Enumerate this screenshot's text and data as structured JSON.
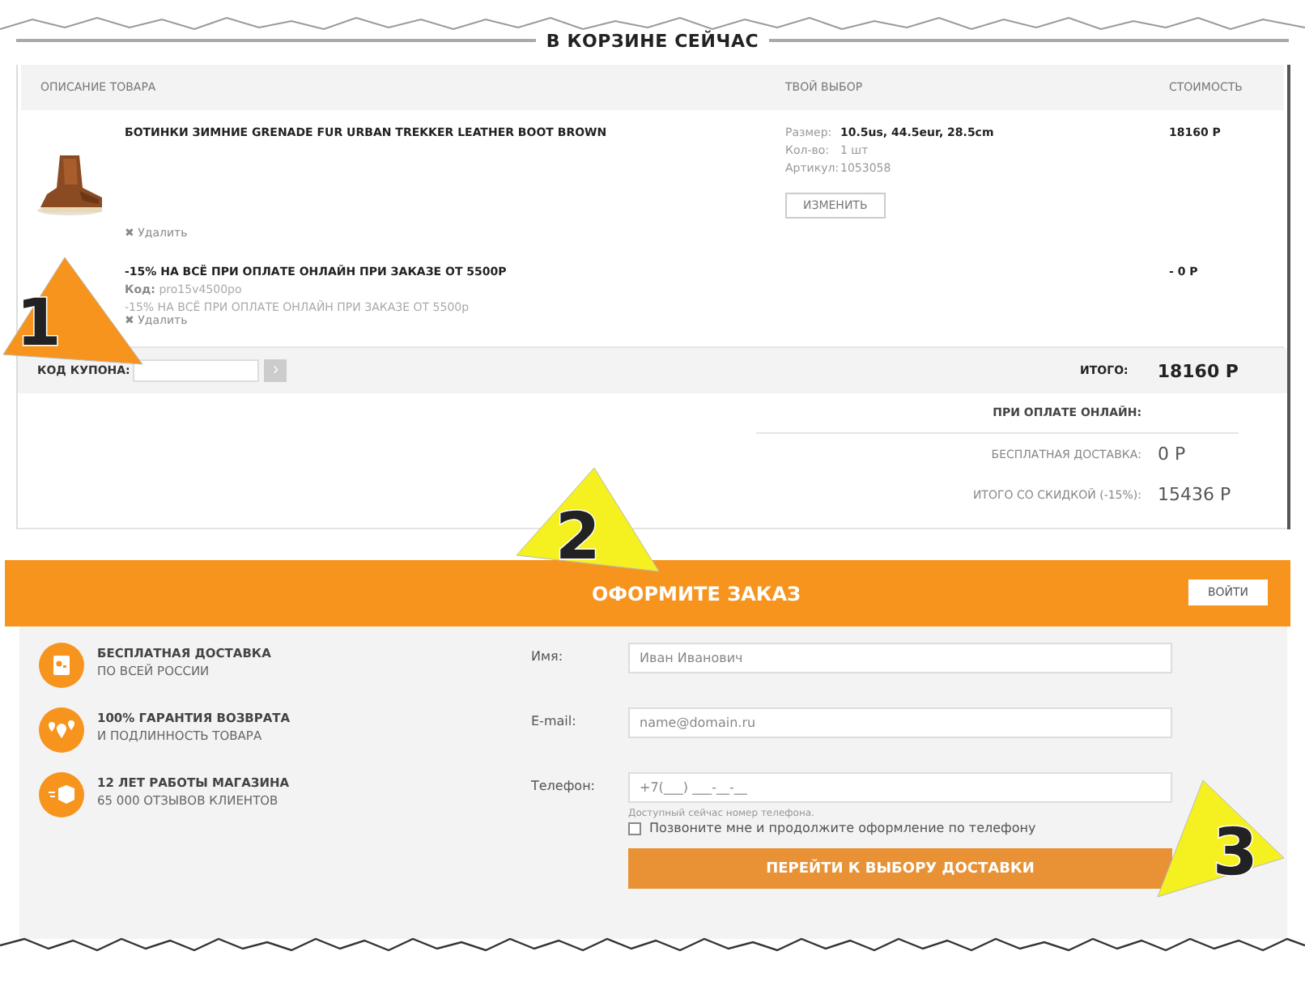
{
  "title": "В КОРЗИНЕ СЕЙЧАС",
  "columns": [
    "ОПИСАНИЕ ТОВАРА",
    "ТВОЙ ВЫБОР",
    "СТОИМОСТЬ"
  ],
  "product": {
    "name": "БОТИНКИ ЗИМНИЕ GRENADE FUR URBAN TREKKER LEATHER BOOT BROWN",
    "delete": "✖ Удалить",
    "options": [
      {
        "label": "Размер:",
        "value": "10.5us, 44.5eur, 28.5cm",
        "bold": true
      },
      {
        "label": "Кол-во:",
        "value": "1 шт",
        "bold": false
      },
      {
        "label": "Артикул:",
        "value": "1053058",
        "bold": false
      }
    ],
    "change_button": "ИЗМЕНИТЬ",
    "price": "18160 Р"
  },
  "promo": {
    "name": "-15% НА ВСЁ ПРИ ОПЛАТЕ ОНЛАЙН ПРИ ЗАКАЗЕ ОТ 5500Р",
    "code_label": "Код:",
    "code": "pro15v4500po",
    "description": "-15% НА ВСЁ ПРИ ОПЛАТЕ ОНЛАЙН ПРИ ЗАКАЗЕ ОТ 5500р",
    "delete": "✖ Удалить",
    "price": "- 0 Р"
  },
  "coupon": {
    "label": "КОД КУПОНА:",
    "submit": "›"
  },
  "total": {
    "label": "ИТОГО:",
    "value": "18160 Р"
  },
  "online": {
    "heading": "ПРИ ОПЛАТЕ ОНЛАЙН:",
    "rows": [
      {
        "label": "БЕСПЛАТНАЯ ДОСТАВКА:",
        "value": "0 Р"
      },
      {
        "label": "ИТОГО СО СКИДКОЙ (-15%):",
        "value": "15436 Р"
      }
    ]
  },
  "checkout": {
    "title": "ОФОРМИТЕ ЗАКАЗ",
    "login": "ВОЙТИ"
  },
  "features": [
    {
      "kind": "parcel",
      "title": "БЕСПЛАТНАЯ ДОСТАВКА",
      "subtitle": "ПО ВСЕЙ РОССИИ"
    },
    {
      "kind": "pins",
      "title": "100% ГАРАНТИЯ ВОЗВРАТА",
      "subtitle": "И ПОДЛИННОСТЬ ТОВАРА"
    },
    {
      "kind": "box",
      "title": "12 ЛЕТ РАБОТЫ МАГАЗИНА",
      "subtitle": "65 000 ОТЗЫВОВ КЛИЕНТОВ"
    }
  ],
  "form": {
    "fields": [
      {
        "label": "Имя:",
        "placeholder": "Иван Иванович"
      },
      {
        "label": "E-mail:",
        "placeholder": "name@domain.ru"
      },
      {
        "label": "Телефон:",
        "placeholder": "+7(___) ___-__-__",
        "hint": "Доступный сейчас номер телефона."
      }
    ],
    "callback": {
      "label": "Позвоните мне и продолжите оформление по телефону",
      "checked": false
    },
    "submit": "ПЕРЕЙТИ К ВЫБОРУ ДОСТАВКИ"
  },
  "annotations": [
    {
      "label": "1",
      "color": "#f7941d"
    },
    {
      "label": "2",
      "color": "#f5f020"
    },
    {
      "label": "3",
      "color": "#f5f020"
    }
  ]
}
